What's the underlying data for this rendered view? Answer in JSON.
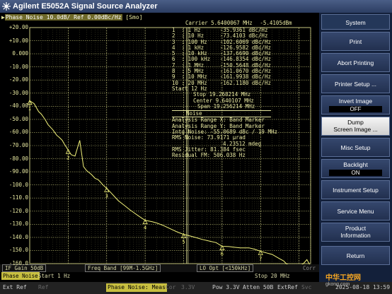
{
  "window": {
    "title": "Agilent E5052A Signal Source Analyzer"
  },
  "trace_header": {
    "prefix": "Phase Noise 10.0dB/ Ref 0.00dBc/Hz",
    "smo": "[Smo]",
    "carrier": "Carrier 5.6400067 MHz",
    "carrier_level": "-5.4105dBm"
  },
  "y_axis": {
    "labels": [
      "+20.00",
      "+10.00",
      "0.000",
      "-10.00",
      "-20.00",
      "-30.00",
      "-40.00",
      "-50.00",
      "-60.00",
      "-70.00",
      "-80.00",
      "-90.00",
      "-100.0",
      "-110.0",
      "-120.0",
      "-130.0",
      "-140.0",
      "-150.0",
      "-160.0"
    ]
  },
  "markers": [
    {
      "n": "1",
      "freq": "1 Hz",
      "val": "-35.9361 dBc/Hz"
    },
    {
      "n": "2",
      "freq": "10 Hz",
      "val": "-73.4103 dBc/Hz"
    },
    {
      "n": "3",
      "freq": "100 Hz",
      "val": "-102.6069 dBc/Hz"
    },
    {
      "n": "4",
      "freq": "1 kHz",
      "val": "-126.9582 dBc/Hz"
    },
    {
      "n": "5",
      "freq": "10 kHz",
      "val": "-137.6690 dBc/Hz"
    },
    {
      "n": "6",
      "freq": "100 kHz",
      "val": "-146.8354 dBc/Hz"
    },
    {
      "n": "7",
      "freq": "1 MHz",
      "val": "-150.5648 dBc/Hz"
    },
    {
      "n": "8",
      "freq": "5 MHz",
      "val": "-161.0670 dBc/Hz"
    },
    {
      "n": "9",
      "freq": "10 MHz",
      "val": "-161.9938 dBc/Hz"
    },
    {
      "n": "10",
      "freq": "20 MHz",
      "val": "-162.1180 dBc/Hz"
    }
  ],
  "noise_info": {
    "start": "Start 12 Hz",
    "stop": "Stop 19.268214 MHz",
    "center": "Center 9.640107 MHz",
    "span": "Span 19.256214 MHz",
    "section": "Noise",
    "range_x": "Analysis Range X: Band Marker",
    "range_y": "Analysis Range Y: Band Marker",
    "integ": "Intg Noise: -55.0689 dBc / 19 MHz",
    "rms_noise_rad": "RMS Noise: 73.9171 µrad",
    "rms_noise_deg": "4.23512 mdeg",
    "rms_jitter": "RMS Jitter: 81.384 fsec",
    "residual_fm": "Residual FM: 506.038 Hz"
  },
  "bottom_bar1": {
    "if_gain": "IF Gain 50dB",
    "freq_band": "Freq Band [99M-1.5GHz]",
    "lo_opt": "LO Opt [<150kHz]",
    "corr": "Corr"
  },
  "bottom_bar2": {
    "mode": "Phase Noise",
    "start": "Start 1 Hz",
    "stop": "Stop 20 MHz"
  },
  "status_bar": [
    "Ext Ref",
    "Ref",
    "Phase Noise: Meas",
    "Cor",
    "3.3V",
    "Pow 3.3V",
    "Atten 50B",
    "ExtRef",
    "Svc",
    "2025-08-18 13:59"
  ],
  "sidebar": {
    "title": "System",
    "buttons": [
      {
        "label": "Print"
      },
      {
        "label": "Abort Printing"
      },
      {
        "label": "Printer Setup ..."
      },
      {
        "label": "Invert Image",
        "value": "OFF"
      },
      {
        "label": "Dump",
        "label2": "Screen Image ..."
      },
      {
        "label": "Misc Setup"
      },
      {
        "label": "Backlight",
        "value": "ON"
      },
      {
        "label": "Instrument Setup"
      },
      {
        "label": "Service Menu"
      },
      {
        "label": "Product",
        "label2": "Information"
      },
      {
        "label": "Return"
      }
    ]
  },
  "watermark": {
    "text": "中华工控网",
    "url": "gkong.com"
  },
  "chart_data": {
    "type": "line",
    "x_scale": "log",
    "xlim": [
      1,
      20000000
    ],
    "ylim": [
      -160,
      20
    ],
    "ylabel_unit": "dBc/Hz",
    "series": [
      {
        "x": [
          1,
          1.3,
          1.7,
          2,
          2.5,
          3,
          4,
          5,
          6,
          7,
          8,
          10,
          12,
          15,
          20,
          25,
          30,
          40,
          50,
          60,
          70,
          80,
          100,
          130,
          150,
          200,
          300,
          400,
          500,
          700,
          1000,
          1500,
          2000,
          3000,
          5000,
          7000,
          10000,
          15000,
          20000,
          30000,
          50000,
          70000,
          100000,
          150000,
          200000,
          300000,
          500000,
          700000,
          1000000,
          1500000,
          2000000,
          3000000,
          4000000,
          5000000,
          7000000,
          10000000,
          13000000,
          16000000,
          20000000
        ],
        "y": [
          -35.9,
          -38,
          -44,
          -46,
          -50,
          -54,
          -58,
          -62,
          -64,
          -66,
          -69,
          -73.4,
          -77,
          -78,
          -66,
          -86,
          -89,
          -92,
          -95,
          -96,
          -98,
          -100,
          -102.6,
          -106,
          -108,
          -112,
          -116,
          -119,
          -121,
          -124,
          -127,
          -128,
          -129,
          -131,
          -134,
          -136,
          -137.7,
          -139,
          -140,
          -141.5,
          -143,
          -144,
          -146.8,
          -147,
          -147.5,
          -148,
          -148,
          -149,
          -150.6,
          -152,
          -153,
          -156,
          -158,
          -161,
          -161.5,
          -162,
          -160,
          -157,
          -162
        ]
      }
    ],
    "marker_points": [
      {
        "n": "1",
        "x": 1,
        "y": -35.9361
      },
      {
        "n": "2",
        "x": 10,
        "y": -73.4103
      },
      {
        "n": "3",
        "x": 100,
        "y": -102.6069
      },
      {
        "n": "4",
        "x": 1000,
        "y": -126.9582
      },
      {
        "n": "5",
        "x": 10000,
        "y": -137.669
      },
      {
        "n": "6",
        "x": 100000,
        "y": -146.8354
      },
      {
        "n": "7",
        "x": 1000000,
        "y": -150.5648
      },
      {
        "n": "8",
        "x": 5000000,
        "y": -161.067
      },
      {
        "n": "9",
        "x": 10000000,
        "y": -161.9938
      },
      {
        "n": "10",
        "x": 20000000,
        "y": -162.118
      }
    ]
  }
}
